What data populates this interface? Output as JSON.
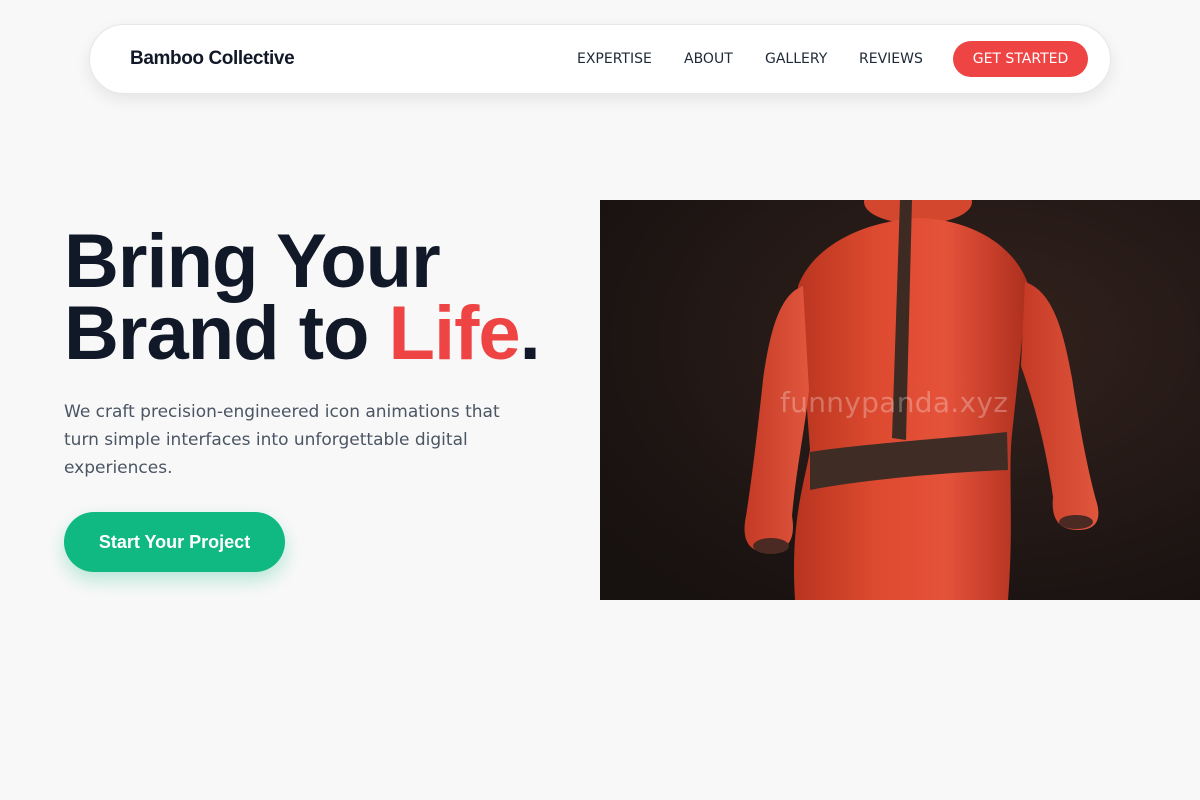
{
  "nav": {
    "brand": "Bamboo Collective",
    "links": [
      "EXPERTISE",
      "ABOUT",
      "GALLERY",
      "REVIEWS"
    ],
    "cta": "GET STARTED"
  },
  "hero": {
    "title_line1": "Bring Your",
    "title_line2_prefix": "Brand to ",
    "title_accent": "Life",
    "title_suffix": ".",
    "description": "We craft precision-engineered icon animations that turn simple interfaces into unforgettable digital experiences.",
    "button": "Start Your Project"
  },
  "image": {
    "subject": "red-clay-figure-back-view",
    "watermark": "funnypanda.xyz"
  },
  "colors": {
    "accent": "#ef4444",
    "primary_button": "#10b981",
    "heading": "#111827",
    "body_text": "#4b5563",
    "background": "#f8f8f8"
  }
}
